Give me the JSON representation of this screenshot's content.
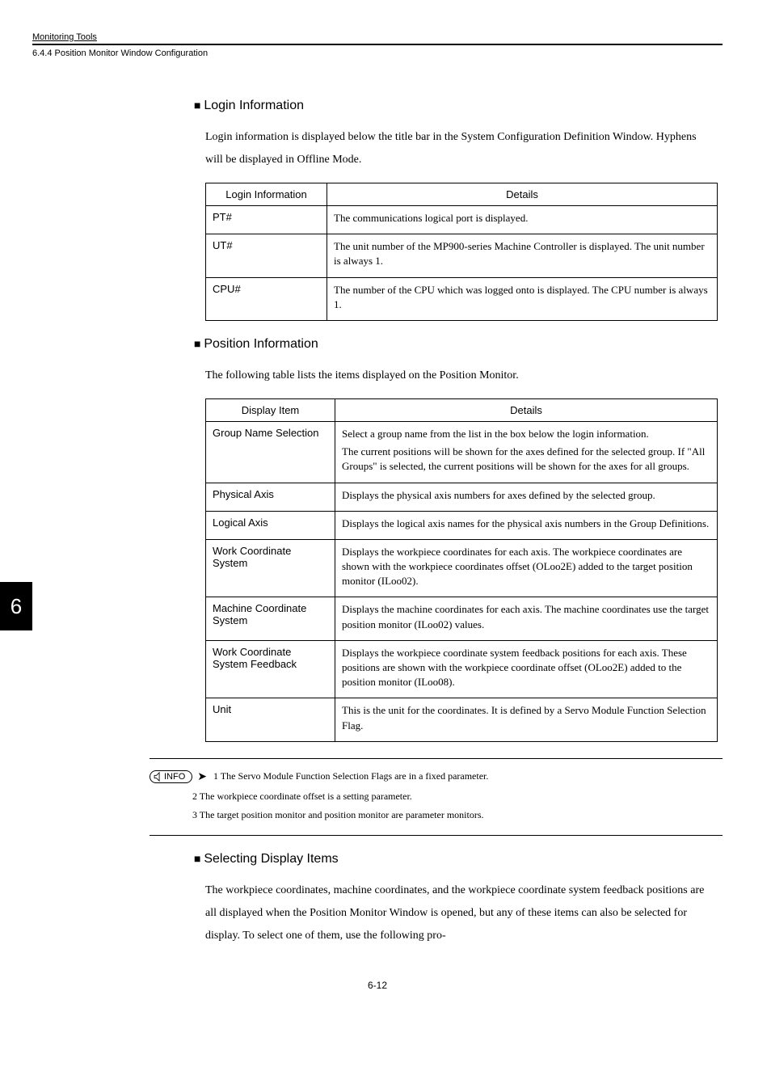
{
  "header": {
    "title": "Monitoring Tools",
    "sub": "6.4.4  Position Monitor Window Configuration"
  },
  "sideTab": "6",
  "sections": {
    "login": {
      "heading": "Login Information",
      "intro": "Login information is displayed below the title bar in the System Configuration Definition Window. Hyphens will be displayed in Offline Mode.",
      "headers": [
        "Login Information",
        "Details"
      ],
      "rows": [
        {
          "label": "PT#",
          "detail": [
            "The communications logical port is displayed."
          ]
        },
        {
          "label": "UT#",
          "detail": [
            "The unit number of the MP900-series Machine Controller is displayed. The unit number is always 1."
          ]
        },
        {
          "label": "CPU#",
          "detail": [
            "The number of the CPU which was logged onto is displayed. The CPU number is always 1."
          ]
        }
      ]
    },
    "position": {
      "heading": "Position Information",
      "intro": "The following table lists the items displayed on the Position Monitor.",
      "headers": [
        "Display Item",
        "Details"
      ],
      "rows": [
        {
          "label": "Group Name Selection",
          "detail": [
            "Select a group name from the list in the box below the login information.",
            "The current positions will be shown for the axes defined for the selected group. If \"All Groups\" is selected, the current positions will be shown for the axes for all groups."
          ]
        },
        {
          "label": "Physical Axis",
          "detail": [
            "Displays the physical axis numbers for axes defined by the selected group."
          ]
        },
        {
          "label": "Logical Axis",
          "detail": [
            "Displays the logical axis names for the physical axis numbers in the Group Definitions."
          ]
        },
        {
          "label": "Work Coordinate System",
          "detail": [
            "Displays the workpiece coordinates for each axis. The workpiece coordinates are shown with the workpiece coordinates offset (OLoo2E) added to the target position monitor (ILoo02)."
          ]
        },
        {
          "label": "Machine Coordinate System",
          "detail": [
            "Displays the machine coordinates for each axis. The machine coordinates use the target position monitor (ILoo02) values."
          ]
        },
        {
          "label": "Work Coordinate System Feedback",
          "detail": [
            "Displays the workpiece coordinate system feedback positions for each axis. These positions are shown with the workpiece coordinate offset (OLoo2E) added to the position monitor (ILoo08)."
          ]
        },
        {
          "label": "Unit",
          "detail": [
            "This is the unit for the coordinates. It is defined by a Servo Module Function Selection Flag."
          ]
        }
      ]
    },
    "info": {
      "badge": "INFO",
      "notes": [
        "1 The Servo Module Function Selection Flags are in a fixed parameter.",
        "2 The workpiece coordinate offset is a setting parameter.",
        "3 The target position monitor and position monitor are parameter monitors."
      ]
    },
    "selecting": {
      "heading": "Selecting Display Items",
      "intro": "The workpiece coordinates, machine coordinates, and the workpiece coordinate system feedback positions are all displayed when the Position Monitor Window is opened, but any of these items can also be selected for display. To select one of them, use the following pro-"
    }
  },
  "pageNum": "6-12"
}
